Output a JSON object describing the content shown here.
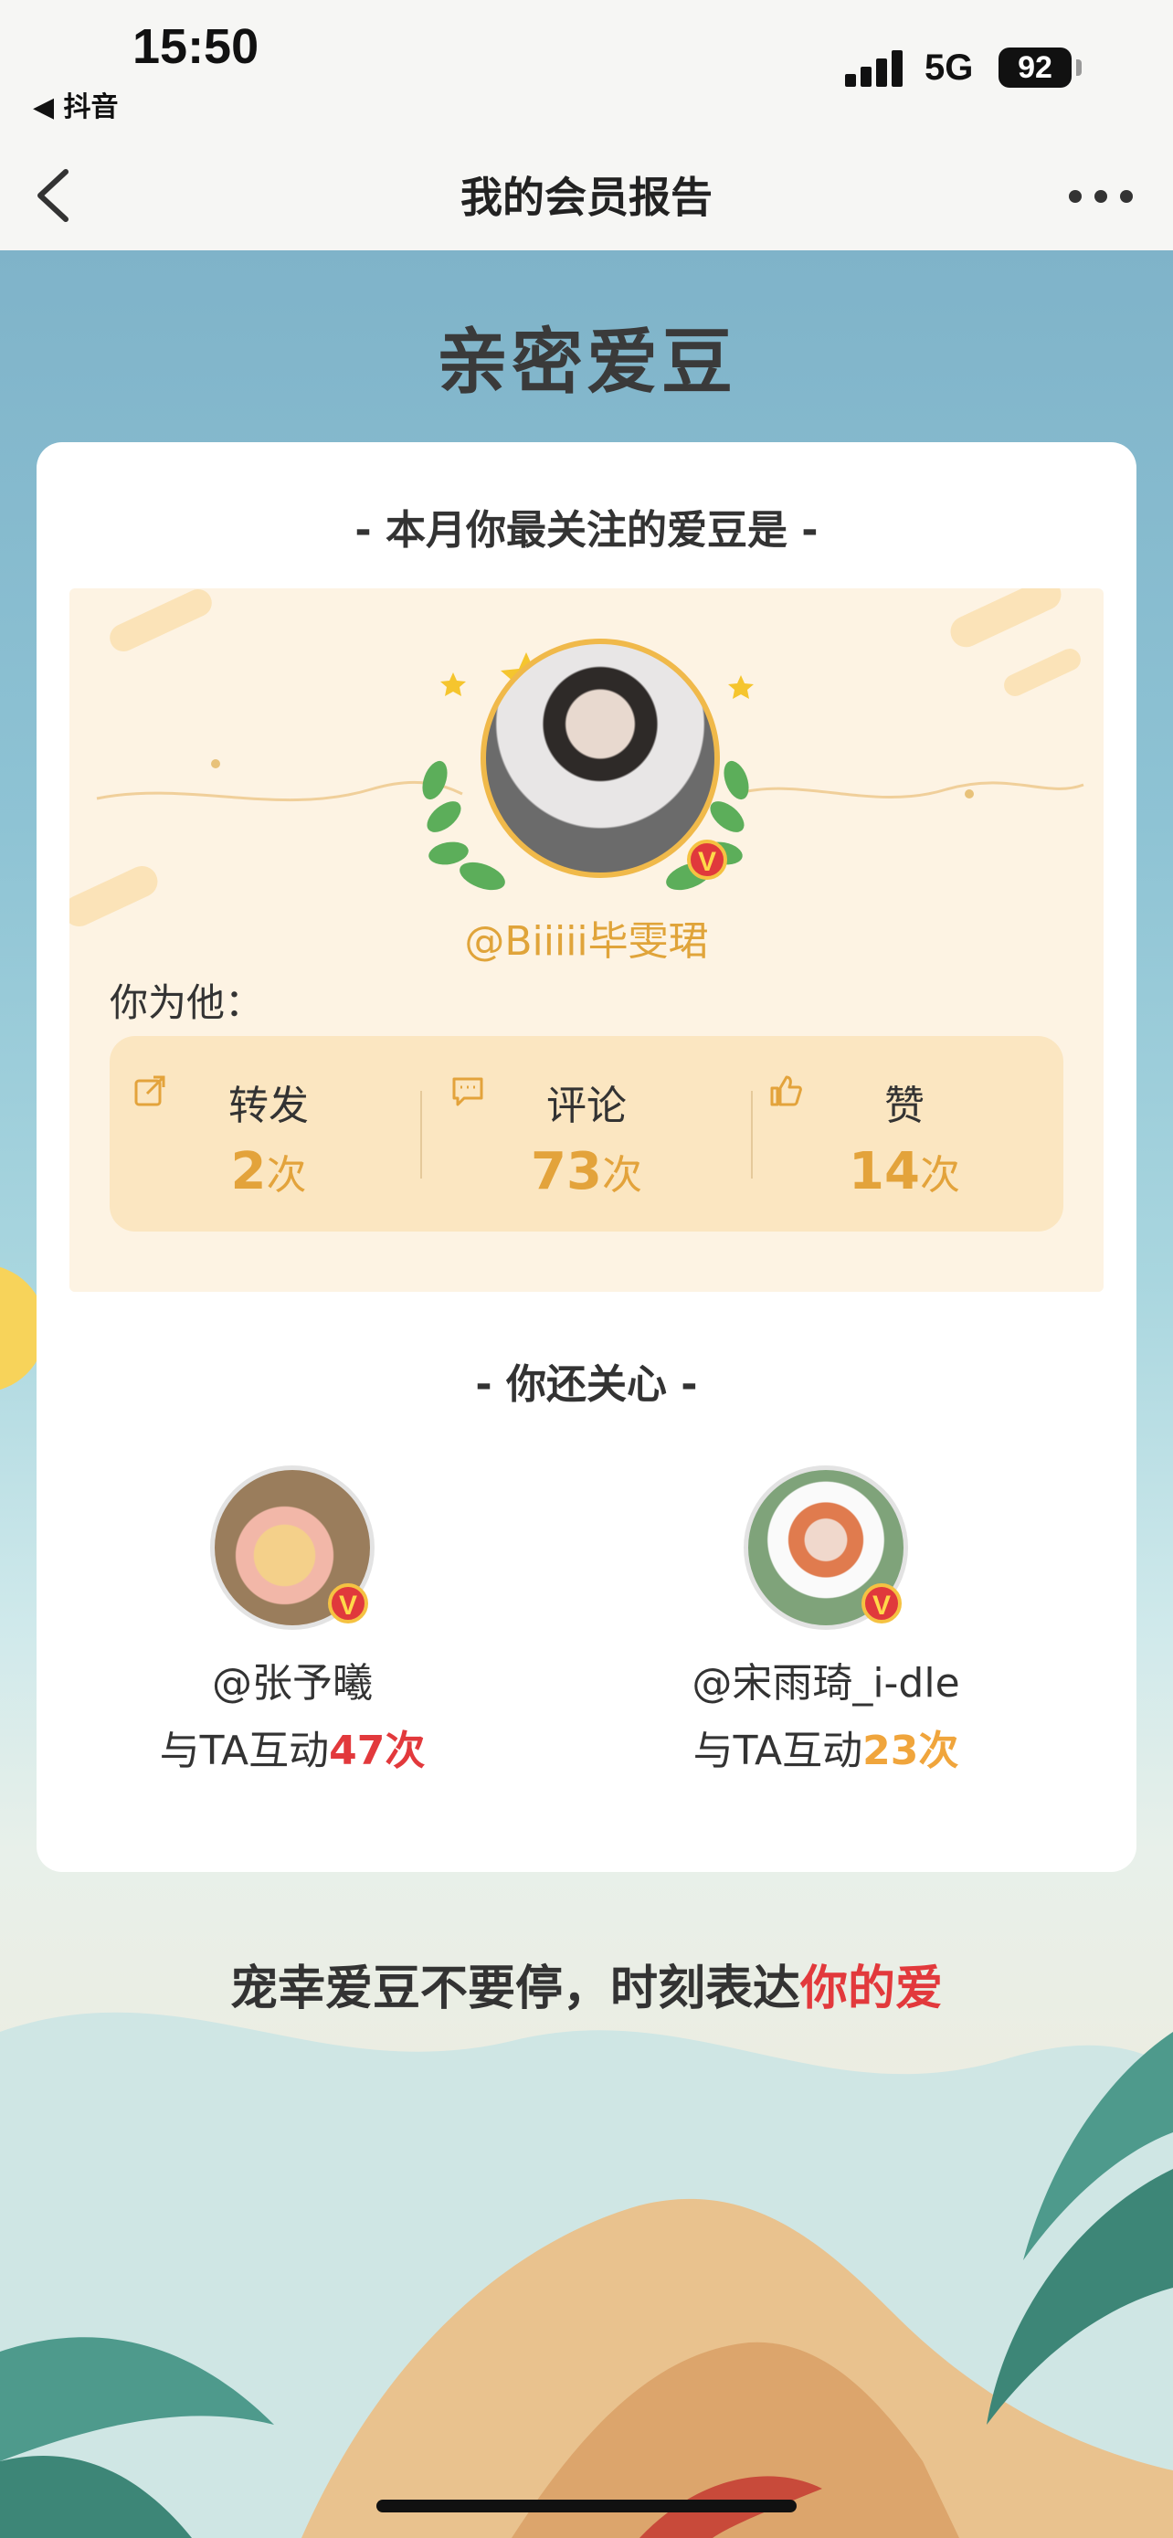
{
  "status_bar": {
    "time": "15:50",
    "back_app": "◀ 抖音",
    "network": "5G",
    "battery": "92"
  },
  "nav": {
    "title": "我的会员报告"
  },
  "page": {
    "heading": "亲密爱豆",
    "card_subtitle": "-  本月你最关注的爱豆是  -",
    "main_idol": {
      "name": "@Biiiii毕雯珺",
      "verified_mark": "V"
    },
    "you_for_label": "你为他：",
    "stats": [
      {
        "icon": "share-icon",
        "label": "转发",
        "value": "2",
        "unit": "次"
      },
      {
        "icon": "comment-icon",
        "label": "评论",
        "value": "73",
        "unit": "次"
      },
      {
        "icon": "like-icon",
        "label": "赞",
        "value": "14",
        "unit": "次"
      }
    ],
    "also_care_title": "-  你还关心  -",
    "friends": [
      {
        "name": "@张予曦",
        "prefix": "与TA互动",
        "count": "47次",
        "count_color": "#e2393c"
      },
      {
        "name": "@宋雨琦_i-dle",
        "prefix": "与TA互动",
        "count": "23次",
        "count_color": "#f0a53c"
      }
    ],
    "slogan_main": "宠幸爱豆不要停，时刻表达",
    "slogan_highlight": "你的爱"
  },
  "colors": {
    "accent_gold": "#e3a33b",
    "highlight_red": "#e2393c"
  }
}
